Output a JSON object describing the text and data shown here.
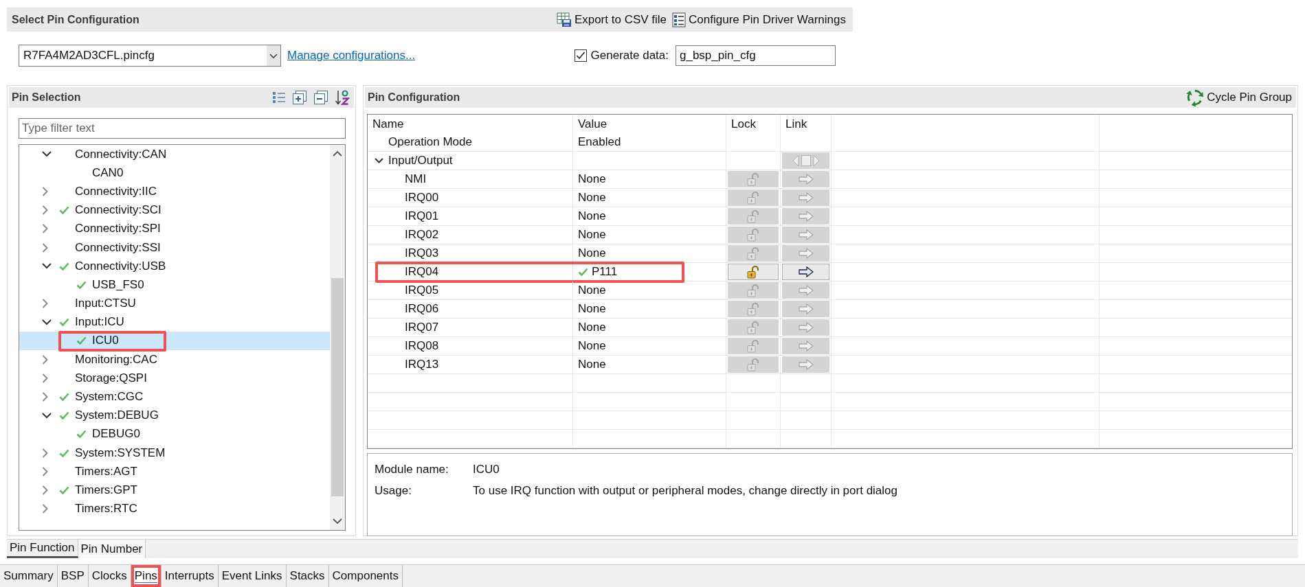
{
  "config_bar": {
    "title": "Select Pin Configuration",
    "actions": [
      {
        "kind": "export",
        "label": "Export to CSV file"
      },
      {
        "kind": "warnings",
        "label": "Configure Pin Driver Warnings"
      }
    ]
  },
  "config_row": {
    "file": "R7FA4M2AD3CFL.pincfg",
    "manage_link": "Manage configurations...",
    "generate_data": {
      "label": "Generate data:",
      "checked": true,
      "value": "g_bsp_pin_cfg"
    }
  },
  "pin_selection": {
    "title": "Pin Selection",
    "filter": {
      "placeholder": "Type filter text"
    },
    "tree": [
      {
        "label": "Connectivity:CAN",
        "expanded": true,
        "checked": false,
        "selected": false,
        "highlighted": false,
        "children": [
          {
            "label": "CAN0",
            "checked": false,
            "selected": false,
            "highlighted": false
          }
        ]
      },
      {
        "label": "Connectivity:IIC",
        "expanded": false,
        "checked": false,
        "selected": false,
        "highlighted": false
      },
      {
        "label": "Connectivity:SCI",
        "expanded": false,
        "checked": true,
        "selected": false,
        "highlighted": false
      },
      {
        "label": "Connectivity:SPI",
        "expanded": false,
        "checked": false,
        "selected": false,
        "highlighted": false
      },
      {
        "label": "Connectivity:SSI",
        "expanded": false,
        "checked": false,
        "selected": false,
        "highlighted": false
      },
      {
        "label": "Connectivity:USB",
        "expanded": true,
        "checked": true,
        "selected": false,
        "highlighted": false,
        "children": [
          {
            "label": "USB_FS0",
            "checked": true,
            "selected": false,
            "highlighted": false
          }
        ]
      },
      {
        "label": "Input:CTSU",
        "expanded": false,
        "checked": false,
        "selected": false,
        "highlighted": false
      },
      {
        "label": "Input:ICU",
        "expanded": true,
        "checked": true,
        "selected": false,
        "highlighted": false,
        "children": [
          {
            "label": "ICU0",
            "checked": true,
            "selected": true,
            "highlighted": true
          }
        ]
      },
      {
        "label": "Monitoring:CAC",
        "expanded": false,
        "checked": false,
        "selected": false,
        "highlighted": false
      },
      {
        "label": "Storage:QSPI",
        "expanded": false,
        "checked": false,
        "selected": false,
        "highlighted": false
      },
      {
        "label": "System:CGC",
        "expanded": false,
        "checked": true,
        "selected": false,
        "highlighted": false
      },
      {
        "label": "System:DEBUG",
        "expanded": true,
        "checked": true,
        "selected": false,
        "highlighted": false,
        "children": [
          {
            "label": "DEBUG0",
            "checked": true,
            "selected": false,
            "highlighted": false
          }
        ]
      },
      {
        "label": "System:SYSTEM",
        "expanded": false,
        "checked": true,
        "selected": false,
        "highlighted": false
      },
      {
        "label": "Timers:AGT",
        "expanded": false,
        "checked": false,
        "selected": false,
        "highlighted": false
      },
      {
        "label": "Timers:GPT",
        "expanded": false,
        "checked": true,
        "selected": false,
        "highlighted": false
      },
      {
        "label": "Timers:RTC",
        "expanded": false,
        "checked": false,
        "selected": false,
        "highlighted": false
      }
    ]
  },
  "pin_configuration": {
    "title": "Pin Configuration",
    "action": "Cycle Pin Group",
    "columns": [
      "Name",
      "Value",
      "Lock",
      "Link"
    ],
    "rows": [
      {
        "kind": "mode",
        "name": "Operation Mode",
        "value": "Enabled"
      },
      {
        "kind": "group",
        "name": "Input/Output",
        "expanded": true,
        "children": [
          {
            "name": "NMI",
            "value": "None",
            "assigned": false,
            "highlighted": false
          },
          {
            "name": "IRQ00",
            "value": "None",
            "assigned": false,
            "highlighted": false
          },
          {
            "name": "IRQ01",
            "value": "None",
            "assigned": false,
            "highlighted": false
          },
          {
            "name": "IRQ02",
            "value": "None",
            "assigned": false,
            "highlighted": false
          },
          {
            "name": "IRQ03",
            "value": "None",
            "assigned": false,
            "highlighted": false
          },
          {
            "name": "IRQ04",
            "value": "P111",
            "assigned": true,
            "highlighted": true
          },
          {
            "name": "IRQ05",
            "value": "None",
            "assigned": false,
            "highlighted": false
          },
          {
            "name": "IRQ06",
            "value": "None",
            "assigned": false,
            "highlighted": false
          },
          {
            "name": "IRQ07",
            "value": "None",
            "assigned": false,
            "highlighted": false
          },
          {
            "name": "IRQ08",
            "value": "None",
            "assigned": false,
            "highlighted": false
          },
          {
            "name": "IRQ13",
            "value": "None",
            "assigned": false,
            "highlighted": false
          }
        ]
      }
    ]
  },
  "details": [
    {
      "label": "Module name:",
      "value": "ICU0"
    },
    {
      "label": "Usage:",
      "value": "To use IRQ function with output or peripheral modes, change directly in port dialog"
    }
  ],
  "view_tabs": [
    {
      "label": "Pin Function",
      "selected": true
    },
    {
      "label": "Pin Number",
      "selected": false
    }
  ],
  "editor_tabs": [
    {
      "label": "Summary",
      "selected": false,
      "highlighted": false
    },
    {
      "label": "BSP",
      "selected": false,
      "highlighted": false
    },
    {
      "label": "Clocks",
      "selected": false,
      "highlighted": false
    },
    {
      "label": "Pins",
      "selected": true,
      "highlighted": true
    },
    {
      "label": "Interrupts",
      "selected": false,
      "highlighted": false
    },
    {
      "label": "Event Links",
      "selected": false,
      "highlighted": false
    },
    {
      "label": "Stacks",
      "selected": false,
      "highlighted": false
    },
    {
      "label": "Components",
      "selected": false,
      "highlighted": false
    }
  ]
}
